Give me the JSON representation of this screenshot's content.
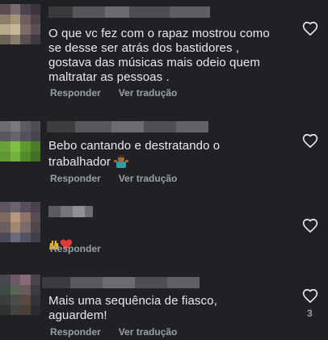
{
  "comments": [
    {
      "text": "O que vc fez com o rapaz mostrou como\nse desse ser atrás dos bastidores ,\ngostava das músicas mais odeio quem\nmaltratar as pessoas .",
      "reply_label": "Responder",
      "translate_label": "Ver tradução"
    },
    {
      "text": "Bebo cantando e destratando o\ntrabalhador",
      "emoji": "🤷🏽‍♂️",
      "reply_label": "Responder",
      "translate_label": "Ver tradução"
    },
    {
      "emoji": "🙌❤️",
      "reply_label": "Responder"
    },
    {
      "text": "Mais uma sequência de fiasco,\naguardem!",
      "reply_label": "Responder",
      "translate_label": "Ver tradução",
      "like_count": "3"
    }
  ],
  "icons": {
    "like": "heart-outline-icon"
  },
  "colors": {
    "background": "#202124",
    "text": "#e8eaed",
    "secondary": "#9aa0a6",
    "heart_emoji": "#e53935",
    "hands_emoji": "#f4b400"
  }
}
